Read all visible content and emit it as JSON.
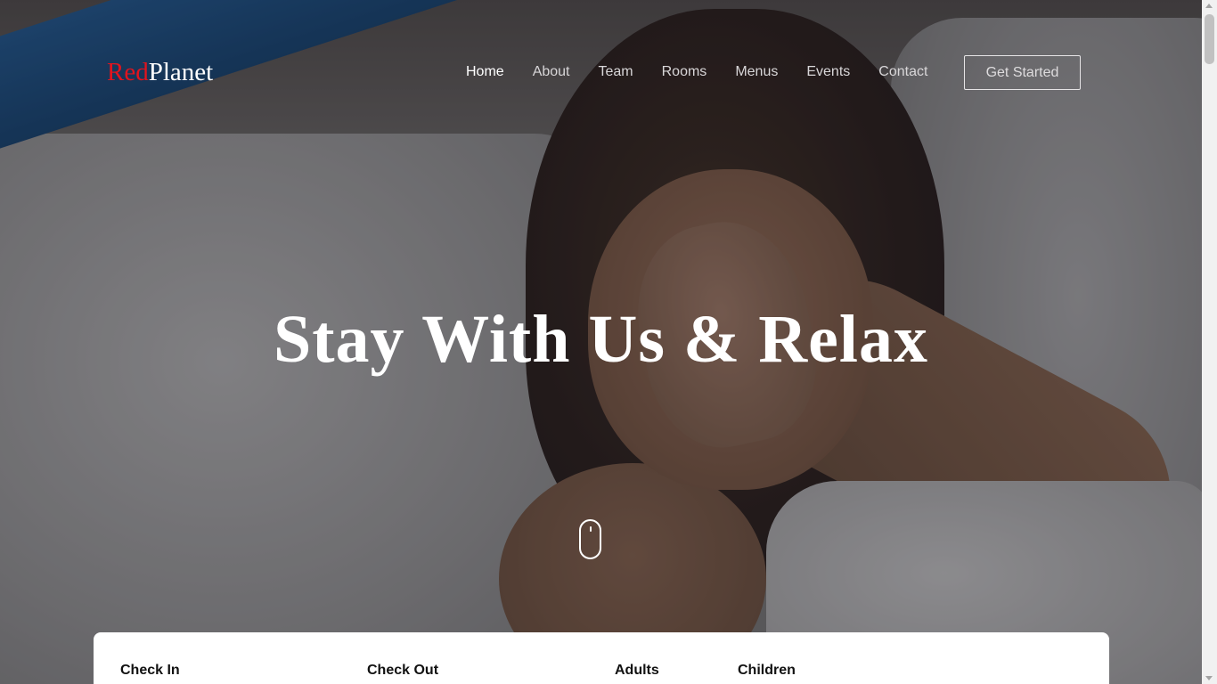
{
  "brand": {
    "part1": "Red",
    "part2": "Planet",
    "accent_color": "#e0141e"
  },
  "nav": {
    "items": [
      {
        "label": "Home",
        "active": true
      },
      {
        "label": "About",
        "active": false
      },
      {
        "label": "Team",
        "active": false
      },
      {
        "label": "Rooms",
        "active": false
      },
      {
        "label": "Menus",
        "active": false
      },
      {
        "label": "Events",
        "active": false
      },
      {
        "label": "Contact",
        "active": false
      }
    ],
    "cta_label": "Get Started"
  },
  "hero": {
    "headline": "Stay With Us & Relax",
    "scroll_indicator": "mouse-scroll-icon"
  },
  "booking": {
    "fields": [
      {
        "label": "Check In"
      },
      {
        "label": "Check Out"
      },
      {
        "label": "Adults"
      },
      {
        "label": "Children"
      }
    ]
  }
}
